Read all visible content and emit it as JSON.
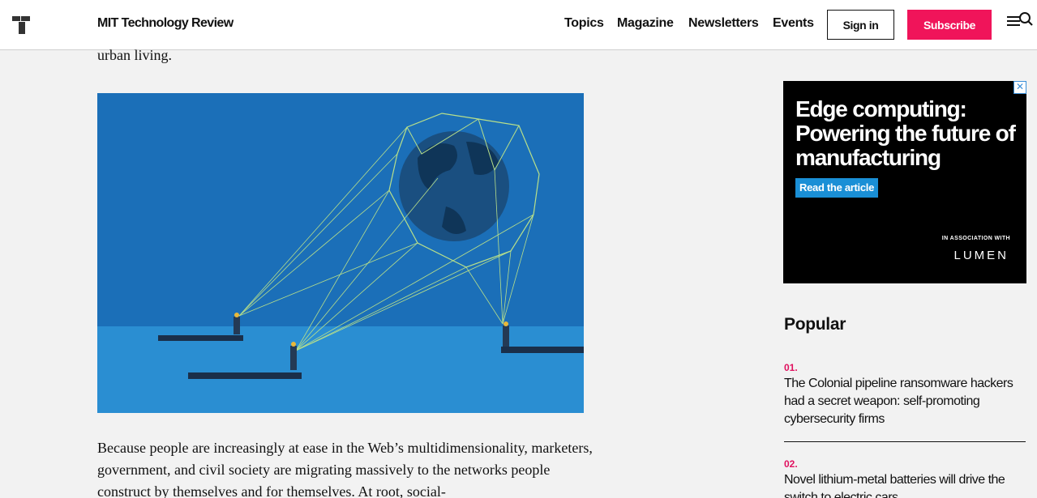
{
  "header": {
    "brand": "MIT Technology Review",
    "nav": [
      "Topics",
      "Magazine",
      "Newsletters",
      "Events"
    ],
    "signin_label": "Sign in",
    "subscribe_label": "Subscribe",
    "logo_icon": "mit-t-logo-icon",
    "menu_icon": "menu-icon",
    "search_icon": "search-icon"
  },
  "article": {
    "fragment": "urban living.",
    "body": "Because people are increasingly at ease in the Web’s multidimensionality, marketers, government, and civil society are migrating massively to the networks people construct by themselves and for themselves. At root, social-"
  },
  "ad": {
    "headline": "Edge computing: Powering the future of manufacturing",
    "cta": "Read the article",
    "association": "IN ASSOCIATION WITH",
    "sponsor": "LUMEN",
    "close_icon": "close-icon"
  },
  "popular": {
    "title": "Popular",
    "items": [
      {
        "num": "01.",
        "title": "The Colonial pipeline ransomware hackers had a secret weapon: self-promoting cybersecurity firms"
      },
      {
        "num": "02.",
        "title": "Novel lithium-metal batteries will drive the switch to electric cars"
      }
    ]
  },
  "colors": {
    "accent": "#f0145a",
    "ad_cta": "#1a8fd6",
    "illustration_sky": "#1b6fb8",
    "illustration_sea": "#2a8ed2"
  }
}
